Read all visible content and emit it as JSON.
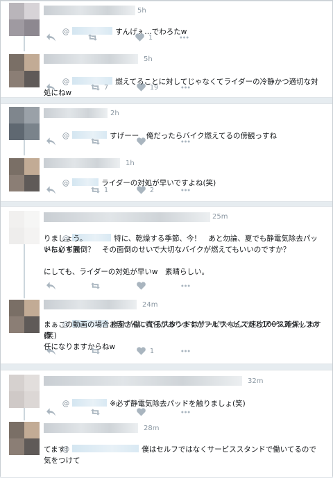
{
  "tweets": [
    {
      "time": "5h",
      "handle_prefix": "@",
      "text": "すんげぇ…でわろたw",
      "reply_count": "",
      "retweet_count": "",
      "like_count": "1"
    },
    {
      "time": "5h",
      "handle_prefix": "@",
      "text": "燃えてることに対してじゃなくてライダーの冷静かつ適切な対処にねw",
      "reply_count": "",
      "retweet_count": "7",
      "like_count": "19"
    },
    {
      "time": "2h",
      "handle_prefix": "@",
      "text": "すげーー　俺だったらバイク燃えてるの傍観っすね",
      "reply_count": "",
      "retweet_count": "",
      "like_count": ""
    },
    {
      "time": "1h",
      "handle_prefix": "@",
      "text": "ライダーの対処が早いですよね(笑)",
      "reply_count": "",
      "retweet_count": "1",
      "like_count": "2"
    },
    {
      "time": "25m",
      "handle_prefix": "@",
      "text": "特に、乾燥する季節、今！　あと勿論、夏でも静電気除去パッドに必ず触",
      "text2": "りましょう。\nいちいち面倒？　その面倒のせいで大切なバイクが燃えてもいいのですか？\n\nにしても、ライダーの対処が早いw　素晴らしい。",
      "reply_count": "",
      "retweet_count": "",
      "like_count": ""
    },
    {
      "time": "24m",
      "handle_prefix": "@",
      "text": "自分が働いてるスタンドはサービスなんで速攻アース確保します(笑)",
      "text2": "まぁこの動画の場合お客さんに責任がありますがフルサービスだと100%スタッフの責\n任になりますからねw",
      "reply_count": "",
      "retweet_count": "",
      "like_count": "1"
    },
    {
      "time": "32m",
      "handle_prefix": "@",
      "text": "※必ず静電気除去パッドを触りましょ(笑)",
      "reply_count": "",
      "retweet_count": "",
      "like_count": ""
    },
    {
      "time": "28m",
      "handle_prefix": "@",
      "text": "僕はセルフではなくサービススタンドで働いてるので気をつけて",
      "text2": "てます！",
      "reply_count": "",
      "retweet_count": "",
      "like_count": ""
    }
  ],
  "icons": {
    "reply": "reply-icon",
    "retweet": "retweet-icon",
    "like": "heart-icon",
    "more": "more-icon"
  }
}
